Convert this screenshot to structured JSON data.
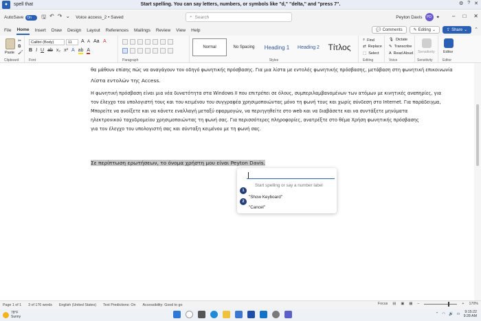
{
  "voice_bar": {
    "command": "spell that",
    "hint": "Start spelling. You can say letters, numbers, or symbols like \"d,\" \"delta,\" and \"press 7\".",
    "gear_icon": "gear-icon",
    "help_icon": "help-icon",
    "close_icon": "close-icon"
  },
  "titlebar": {
    "autosave_label": "AutoSave",
    "autosave_state": "On",
    "document_name": "Voice access_2 • Saved",
    "search_placeholder": "Search",
    "user_name": "Peyton Davis",
    "user_initials": "PD",
    "accent": "#2b5fb3"
  },
  "tabs": [
    "File",
    "Home",
    "Insert",
    "Draw",
    "Design",
    "Layout",
    "References",
    "Mailings",
    "Review",
    "View",
    "Help"
  ],
  "active_tab": "Home",
  "tab_actions": {
    "comments": "Comments",
    "editing": "Editing",
    "share": "Share"
  },
  "ribbon": {
    "clipboard": {
      "paste": "Paste",
      "label": "Clipboard"
    },
    "font": {
      "name": "Calibri (Body)",
      "size": "11",
      "label": "Font"
    },
    "paragraph": {
      "label": "Paragraph"
    },
    "styles": {
      "items": [
        "Normal",
        "No Spacing",
        "Heading 1",
        "Heading 2",
        "Τίτλος"
      ],
      "selected": "Normal",
      "label": "Styles"
    },
    "editing": {
      "items": [
        "Find",
        "Replace",
        "Select"
      ],
      "label": "Editing"
    },
    "voice": {
      "dictate": "Dictate",
      "transcribe": "Transcribe",
      "read_aloud": "Read Aloud",
      "label": "Voice"
    },
    "sensitivity": {
      "button": "Sensitivity",
      "label": "Sensitivity"
    },
    "editor": {
      "button": "Editor",
      "label": "Editor"
    }
  },
  "document": {
    "line1": "θα μάθουν επίσης πώς να αναγάγουν τον οδηγό φωνητικής πρόσβασης. Για μια λίστα με εντολές φωνητικής πρόσβασης, μετάβαση στη φωνητική επικοινωνία",
    "line2": "Λίστα εντολών της Access.",
    "paragraph": [
      "Η φωνητική πρόσβαση είναι μια νέα δυνατότητα στα Windows II που επιτρέπει σε όλους, συμπεριλαμβανομένων των ατόμων με κινητικές αναπηρίες, για",
      "τον έλεγχο του υπολογιστή τους και του κειμένου του συγγραφέα χρησιμοποιώντας μόνο τη φωνή τους και χωρίς σύνδεση στο Internet. Για παράδειγμα,",
      "Μπορείτε να ανοίξετε και να κάνετε εναλλαγή μεταξύ εφαρμογών, να περιηγηθείτε στο web και να διαβάσετε και να συντάξετε μηνύματα",
      "ηλεκτρονικού ταχυδρομείου χρησιμοποιώντας τη φωνή σας. Για περισσότερες πληροφορίες, ανατρέξτε στο θέμα Χρήση φωνητικής πρόσβασης",
      "για τον έλεγχο του υπολογιστή σας και σύνταξη κειμένου με τη φωνή σας."
    ],
    "selected_line": "Σε περίπτωση ερωτήσεων, το όνομα χρήστη μου είναι Peyton Davis.",
    "selection_color": "#c9c9c9"
  },
  "spell_popup": {
    "placeholder": "Start spelling or say a number label",
    "options": [
      {
        "number": "1",
        "label": "\"Show Keyboard\""
      },
      {
        "number": "2",
        "label": "\"Cancel\""
      }
    ]
  },
  "statusbar": {
    "page": "Page 1 of 1",
    "words": "3 of 176 words",
    "language": "English (United States)",
    "predictions": "Text Predictions: On",
    "accessibility": "Accessibility: Good to go",
    "focus": "Focus",
    "zoom": "170%"
  },
  "taskbar": {
    "temperature": "78°F",
    "weather": "Sunny",
    "time": "9:15:22",
    "date": "9:28 AM",
    "apps": [
      "windows-start-icon",
      "search-icon",
      "task-view-icon",
      "edge-icon",
      "file-explorer-icon",
      "store-icon",
      "word-icon",
      "outlook-icon",
      "settings-icon",
      "teams-icon"
    ]
  }
}
